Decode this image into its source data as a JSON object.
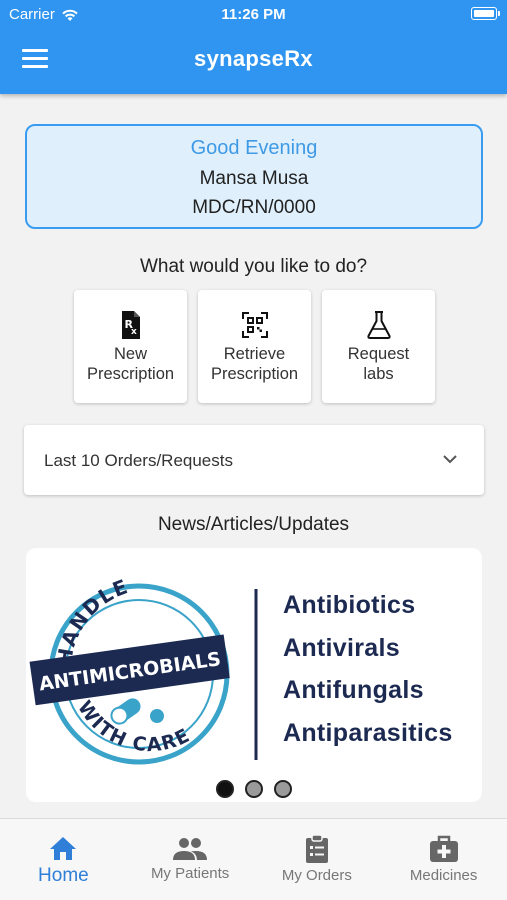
{
  "status_bar": {
    "carrier": "Carrier",
    "time": "11:26 PM"
  },
  "app_bar": {
    "title": "synapseRx"
  },
  "greeting": {
    "salutation": "Good Evening",
    "name": "Mansa Musa",
    "id": "MDC/RN/0000"
  },
  "prompt": "What would you like to do?",
  "actions": [
    {
      "line1": "New",
      "line2": "Prescription",
      "icon": "prescription-icon"
    },
    {
      "line1": "Retrieve",
      "line2": "Prescription",
      "icon": "qr-code-icon"
    },
    {
      "line1": "Request",
      "line2": "labs",
      "icon": "flask-icon"
    }
  ],
  "orders_panel": {
    "label": "Last 10 Orders/Requests"
  },
  "news": {
    "title": "News/Articles/Updates",
    "banner": {
      "seal_top": "HANDLE",
      "seal_ribbon": "ANTIMICROBIALS",
      "seal_bottom": "WITH CARE",
      "items": [
        "Antibiotics",
        "Antivirals",
        "Antifungals",
        "Antiparasitics"
      ]
    },
    "pages": 3,
    "current_page": 1
  },
  "tabs": [
    {
      "label": "Home",
      "icon": "home-icon",
      "active": true
    },
    {
      "label": "My Patients",
      "icon": "people-icon"
    },
    {
      "label": "My Orders",
      "icon": "clipboard-icon"
    },
    {
      "label": "Medicines",
      "icon": "medical-kit-icon"
    }
  ],
  "colors": {
    "primary": "#2f95f0",
    "greeting_bg": "#dff0fc",
    "banner_text": "#1c2a52",
    "seal_teal": "#3aa3c9"
  }
}
